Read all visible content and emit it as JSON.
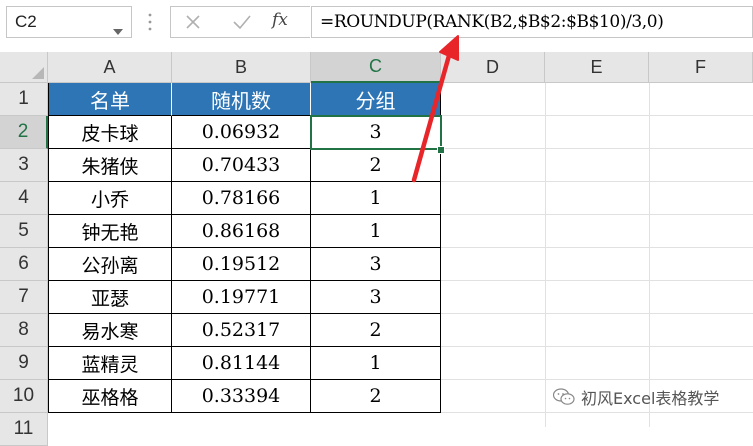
{
  "formula_bar": {
    "name_box": "C2",
    "fx_label": "fx",
    "formula": "=ROUNDUP(RANK(B2,$B$2:$B$10)/3,0)"
  },
  "columns": [
    "A",
    "B",
    "C",
    "D",
    "E",
    "F"
  ],
  "rows": [
    "1",
    "2",
    "3",
    "4",
    "5",
    "6",
    "7",
    "8",
    "9",
    "10",
    "11"
  ],
  "table": {
    "headers": [
      "名单",
      "随机数",
      "分组"
    ],
    "rows": [
      [
        "皮卡球",
        "0.06932",
        "3"
      ],
      [
        "朱猪侠",
        "0.70433",
        "2"
      ],
      [
        "小乔",
        "0.78166",
        "1"
      ],
      [
        "钟无艳",
        "0.86168",
        "1"
      ],
      [
        "公孙离",
        "0.19512",
        "3"
      ],
      [
        "亚瑟",
        "0.19771",
        "3"
      ],
      [
        "易水寒",
        "0.52317",
        "2"
      ],
      [
        "蓝精灵",
        "0.81144",
        "1"
      ],
      [
        "巫格格",
        "0.33394",
        "2"
      ]
    ]
  },
  "selected_cell": "C2",
  "colors": {
    "header_fill": "#2e75b6",
    "selection": "#217346",
    "annotation_arrow": "#e8262a"
  },
  "watermark": "初风Excel表格教学"
}
